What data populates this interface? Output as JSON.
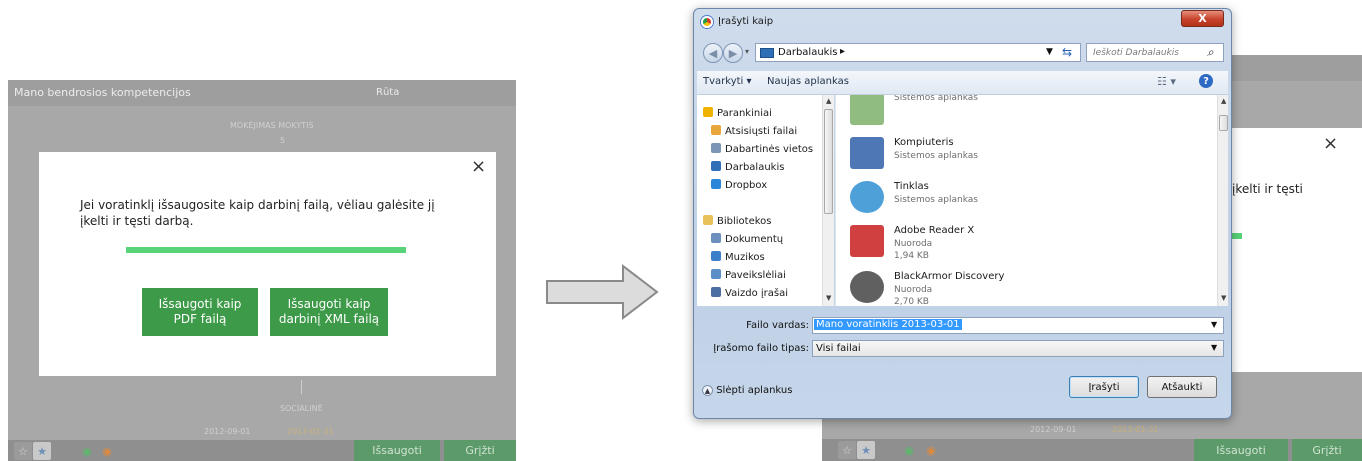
{
  "left": {
    "header_title": "Mano bendrosios kompetencijos",
    "header_user": "Rūta",
    "chart_top_label": "MOKĖJIMAS MOKYTIS",
    "chart_top_tick": "5",
    "chart_bottom_label": "SOCIALINĖ",
    "date_from": "2012-09-01",
    "date_to": "2013-01-31",
    "modal": {
      "close": "×",
      "text": "Jei voratinklį išsaugosite kaip darbinį failą, vėliau galėsite jį įkelti ir tęsti darbą.",
      "progress_percent": 100,
      "btn_pdf": "Išsaugoti kaip\nPDF failą",
      "btn_xml": "Išsaugoti kaip\ndarbinį XML failą"
    },
    "footer": {
      "save": "Išsaugoti",
      "back": "Grįžti"
    }
  },
  "right": {
    "behind_text": "įkelti ir tęsti",
    "behind_close": "×",
    "date_from": "2012-09-01",
    "date_to": "2013-01-31",
    "footer": {
      "save": "Išsaugoti",
      "back": "Grįžti"
    },
    "dialog": {
      "title": "Įrašyti kaip",
      "close": "X",
      "address": "Darbalaukis",
      "address_arrow": "▸",
      "search_placeholder": "Ieškoti Darbalaukis",
      "toolbar_organize": "Tvarkyti ▾",
      "toolbar_new_folder": "Naujas aplankas",
      "nav_items": [
        {
          "label": "Parankiniai",
          "icon": "star-icon",
          "color": "#f0b400"
        },
        {
          "label": "Atsisiųsti failai",
          "icon": "download-folder-icon",
          "color": "#e8a73d"
        },
        {
          "label": "Dabartinės vietos",
          "icon": "recent-places-icon",
          "color": "#7b96b6"
        },
        {
          "label": "Darbalaukis",
          "icon": "desktop-icon",
          "color": "#2f6fb7"
        },
        {
          "label": "Dropbox",
          "icon": "dropbox-icon",
          "color": "#2a86d8"
        },
        {
          "label": "Bibliotekos",
          "icon": "libraries-icon",
          "color": "#e8c15b"
        },
        {
          "label": "Dokumentų",
          "icon": "documents-icon",
          "color": "#6b8fbf"
        },
        {
          "label": "Muzikos",
          "icon": "music-icon",
          "color": "#3d7fc8"
        },
        {
          "label": "Paveikslėliai",
          "icon": "pictures-icon",
          "color": "#5a8fc7"
        },
        {
          "label": "Vaizdo įrašai",
          "icon": "videos-icon",
          "color": "#4a6fa0"
        }
      ],
      "files": [
        {
          "name": "",
          "sub": "Sistemos aplankas",
          "icon": "user-folder-icon"
        },
        {
          "name": "Kompiuteris",
          "sub": "Sistemos aplankas",
          "icon": "computer-icon"
        },
        {
          "name": "Tinklas",
          "sub": "Sistemos aplankas",
          "icon": "network-icon"
        },
        {
          "name": "Adobe Reader X",
          "sub": "Nuoroda",
          "sub2": "1,94 KB",
          "icon": "adobe-reader-icon"
        },
        {
          "name": "BlackArmor Discovery",
          "sub": "Nuoroda",
          "sub2": "2,70 KB",
          "icon": "blackarmor-icon"
        }
      ],
      "filename_label": "Failo vardas:",
      "filename_value": "Mano voratinklis 2013-03-01",
      "filetype_label": "Įrašomo failo tipas:",
      "filetype_value": "Visi failai",
      "hide_folders": "Slėpti aplankus",
      "save_btn": "Įrašyti",
      "cancel_btn": "Atšaukti"
    }
  }
}
